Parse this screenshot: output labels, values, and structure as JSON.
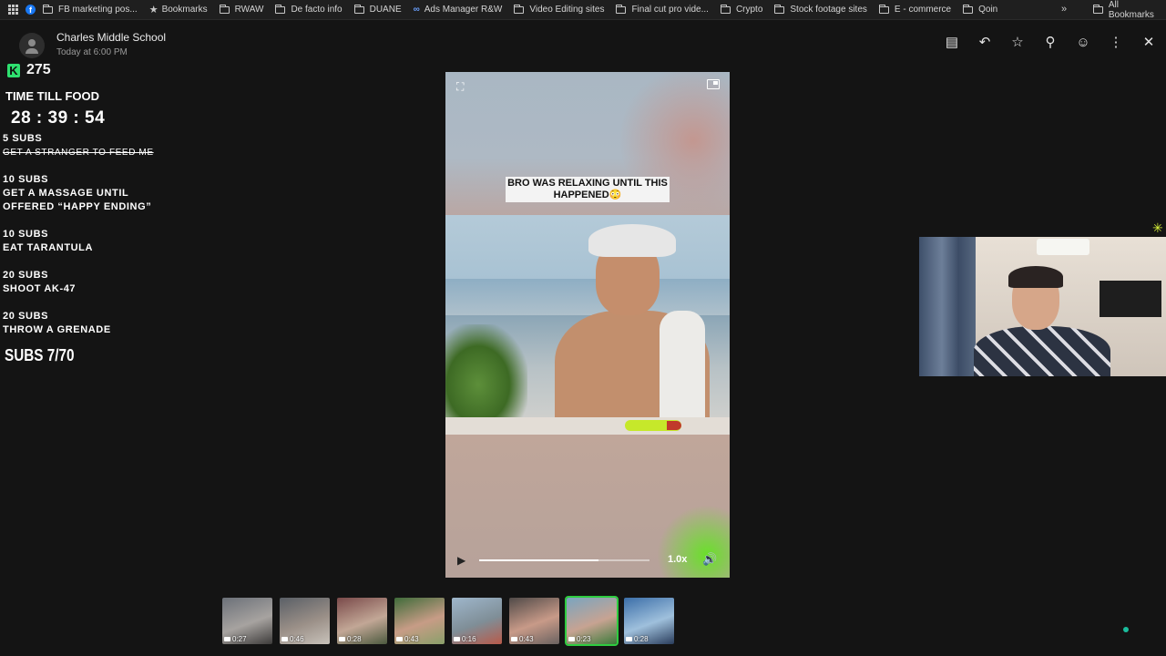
{
  "bookmarks": {
    "items": [
      "FB marketing pos...",
      "Bookmarks",
      "RWAW",
      "De facto info",
      "DUANE",
      "Ads Manager R&W",
      "Video Editing sites",
      "Final cut pro vide...",
      "Crypto",
      "Stock footage sites",
      "E - commerce",
      "Qoin"
    ],
    "all_label": "All Bookmarks",
    "overflow": "»"
  },
  "message": {
    "sender": "Charles Middle School",
    "timestamp": "Today at 6:00 PM"
  },
  "toolbar": {
    "icons": [
      "subtitles-icon",
      "reply-icon",
      "star-icon",
      "pin-icon",
      "emoji-icon",
      "more-icon",
      "close-icon"
    ]
  },
  "kick": {
    "logo": "K",
    "count": "275"
  },
  "overlay": {
    "time_label": "TIME TILL FOOD",
    "timer": "28 : 39 : 54",
    "goals": [
      {
        "subs": "5 SUBS",
        "task": "GET A STRANGER TO FEED ME",
        "done": true
      },
      {
        "subs": "10 SUBS",
        "task": "GET A MASSAGE UNTIL\nOFFERED “HAPPY ENDING”",
        "done": false
      },
      {
        "subs": "10 SUBS",
        "task": "EAT TARANTULA",
        "done": false
      },
      {
        "subs": "20 SUBS",
        "task": "SHOOT AK-47",
        "done": false
      },
      {
        "subs": "20 SUBS",
        "task": "THROW A GRENADE",
        "done": false
      }
    ],
    "subs_count": "SUBS 7/70"
  },
  "player": {
    "caption": "BRO WAS RELAXING UNTIL THIS HAPPENED😳",
    "speed": "1.0x",
    "progress": 0.7
  },
  "thumbnails": [
    {
      "duration": "0:27",
      "colors": [
        "#6b7078",
        "#a7a3a0",
        "#3d3b3a"
      ]
    },
    {
      "duration": "0:46",
      "colors": [
        "#5a5f66",
        "#9b9088",
        "#c8c2ba"
      ]
    },
    {
      "duration": "0:28",
      "colors": [
        "#7a4a4a",
        "#c2a796",
        "#4c5a3f"
      ]
    },
    {
      "duration": "0:43",
      "colors": [
        "#3f6b3a",
        "#c79c86",
        "#8aa06a"
      ]
    },
    {
      "duration": "0:16",
      "colors": [
        "#9fb7cc",
        "#7f8e97",
        "#b85a4a"
      ]
    },
    {
      "duration": "0:43",
      "colors": [
        "#504a48",
        "#c89a88",
        "#6a6260"
      ]
    },
    {
      "duration": "0:23",
      "colors": [
        "#7aa5c0",
        "#c7a392",
        "#3b7a3a"
      ],
      "selected": true
    },
    {
      "duration": "0:28",
      "colors": [
        "#3b6ea8",
        "#9fc0dc",
        "#2a3d5c"
      ]
    }
  ]
}
